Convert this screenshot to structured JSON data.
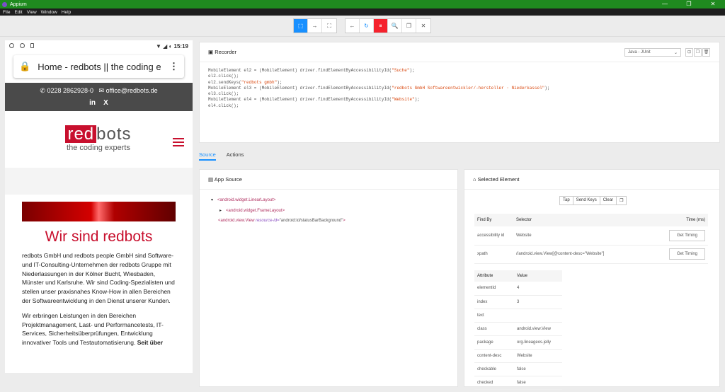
{
  "window": {
    "title": "Appium",
    "controls": [
      "—",
      "❐",
      "✕"
    ]
  },
  "menu": [
    "File",
    "Edit",
    "View",
    "Window",
    "Help"
  ],
  "toolbar": {
    "group1": [
      "⬚",
      "→",
      "⛶"
    ],
    "group2": [
      "←",
      "↻",
      "⏸",
      "🔍",
      "❐",
      "✕"
    ]
  },
  "device": {
    "clock": "15:19",
    "address": "Home - redbots || the coding e",
    "phone": "0228 2862928-0",
    "email": "office@redbots.de",
    "social": [
      "in",
      "X"
    ],
    "logo_red": "red",
    "logo_bots": "bots",
    "tagline": "the coding experts",
    "headline": "Wir sind redbots",
    "para1": "redbots GmbH und redbots people GmbH sind Software- und IT-Consulting-Unternehmen der redbots Gruppe mit Niederlassungen in der Kölner Bucht, Wiesbaden, Münster und Karlsruhe. Wir sind Coding-Spezialisten und stellen unser praxisnahes Know-How in allen Bereichen der Softwareentwicklung in den Dienst unserer Kunden.",
    "para2a": "Wir erbringen Leistungen in den Bereichen Projektmanagement, Last- und Performancetests, IT-Services, Sicherheitsüberprüfungen, Entwicklung innovativer Tools und Testautomatisierung.",
    "para2b": "Seit über"
  },
  "recorder": {
    "title": "Recorder",
    "language": "Java - JUnit",
    "lines": [
      {
        "pre": "MobileElement el2 = (MobileElement) driver.findElementByAccessibilityId(",
        "str": "\"Suche\"",
        "post": ");"
      },
      {
        "pre": "el2.click();",
        "str": "",
        "post": ""
      },
      {
        "pre": "el2.sendKeys(",
        "str": "\"redbots gmbh\"",
        "post": ");"
      },
      {
        "pre": "MobileElement el3 = (MobileElement) driver.findElementByAccessibilityId(",
        "str": "\"redbots GmbH Softwareentwickler/-hersteller · Niederkassel\"",
        "post": ");"
      },
      {
        "pre": "el3.click();",
        "str": "",
        "post": ""
      },
      {
        "pre": "MobileElement el4 = (MobileElement) driver.findElementByAccessibilityId(",
        "str": "\"Website\"",
        "post": ");"
      },
      {
        "pre": "el4.click();",
        "str": "",
        "post": ""
      }
    ]
  },
  "tabs": [
    "Source",
    "Actions"
  ],
  "app_source": {
    "title": "App Source",
    "nodes": [
      {
        "toggle": "▾",
        "tag": "<android.widget.LinearLayout>",
        "attr": "",
        "val": "",
        "end": "",
        "indent": 0
      },
      {
        "toggle": "▸",
        "tag": "<android.widget.FrameLayout>",
        "attr": "",
        "val": "",
        "end": "",
        "indent": 12
      },
      {
        "toggle": "",
        "tag": "<android.view.View",
        "attr": " resource-id=",
        "val": "\"android:id/statusBarBackground\"",
        "end": ">",
        "indent": 0
      }
    ]
  },
  "selected": {
    "title": "Selected Element",
    "actions": [
      "Tap",
      "Send Keys",
      "Clear",
      "❐"
    ],
    "findby_headers": [
      "Find By",
      "Selector",
      "Time (ms)"
    ],
    "findby_rows": [
      {
        "by": "accessibility id",
        "selector": "Website",
        "button": "Get Timing"
      },
      {
        "by": "xpath",
        "selector": "//android.view.View[@content-desc=\"Website\"]",
        "button": "Get Timing"
      }
    ],
    "attr_headers": [
      "Attribute",
      "Value"
    ],
    "attrs": [
      [
        "elementId",
        "4"
      ],
      [
        "index",
        "3"
      ],
      [
        "text",
        ""
      ],
      [
        "class",
        "android.view.View"
      ],
      [
        "package",
        "org.lineageos.jelly"
      ],
      [
        "content-desc",
        "Website"
      ],
      [
        "checkable",
        "false"
      ],
      [
        "checked",
        "false"
      ]
    ]
  }
}
